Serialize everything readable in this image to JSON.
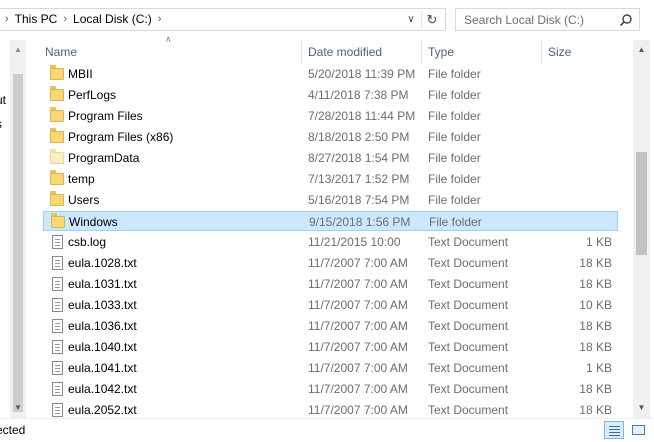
{
  "address": {
    "breadcrumbs": [
      "This PC",
      "Local Disk (C:)"
    ]
  },
  "search": {
    "placeholder": "Search Local Disk (C:)"
  },
  "nav": {
    "partial_lines": [
      "ut",
      "s"
    ]
  },
  "columns": {
    "name": "Name",
    "date": "Date modified",
    "type": "Type",
    "size": "Size"
  },
  "rows": [
    {
      "name": "MBII",
      "date": "5/20/2018 11:39 PM",
      "type": "File folder",
      "size": "",
      "icon": "folder-icon"
    },
    {
      "name": "PerfLogs",
      "date": "4/11/2018 7:38 PM",
      "type": "File folder",
      "size": "",
      "icon": "folder-icon"
    },
    {
      "name": "Program Files",
      "date": "7/28/2018 11:44 PM",
      "type": "File folder",
      "size": "",
      "icon": "folder-icon"
    },
    {
      "name": "Program Files (x86)",
      "date": "8/18/2018 2:50 PM",
      "type": "File folder",
      "size": "",
      "icon": "folder-icon"
    },
    {
      "name": "ProgramData",
      "date": "8/27/2018 1:54 PM",
      "type": "File folder",
      "size": "",
      "icon": "folder-hidden-icon"
    },
    {
      "name": "temp",
      "date": "7/13/2017 1:52 PM",
      "type": "File folder",
      "size": "",
      "icon": "folder-icon"
    },
    {
      "name": "Users",
      "date": "5/16/2018 7:54 PM",
      "type": "File folder",
      "size": "",
      "icon": "folder-icon"
    },
    {
      "name": "Windows",
      "date": "9/15/2018 1:56 PM",
      "type": "File folder",
      "size": "",
      "icon": "folder-icon",
      "selected": true
    },
    {
      "name": "csb.log",
      "date": "11/21/2015 10:00",
      "type": "Text Document",
      "size": "1 KB",
      "icon": "text-document-icon"
    },
    {
      "name": "eula.1028.txt",
      "date": "11/7/2007 7:00 AM",
      "type": "Text Document",
      "size": "18 KB",
      "icon": "text-document-icon"
    },
    {
      "name": "eula.1031.txt",
      "date": "11/7/2007 7:00 AM",
      "type": "Text Document",
      "size": "18 KB",
      "icon": "text-document-icon"
    },
    {
      "name": "eula.1033.txt",
      "date": "11/7/2007 7:00 AM",
      "type": "Text Document",
      "size": "10 KB",
      "icon": "text-document-icon"
    },
    {
      "name": "eula.1036.txt",
      "date": "11/7/2007 7:00 AM",
      "type": "Text Document",
      "size": "18 KB",
      "icon": "text-document-icon"
    },
    {
      "name": "eula.1040.txt",
      "date": "11/7/2007 7:00 AM",
      "type": "Text Document",
      "size": "18 KB",
      "icon": "text-document-icon"
    },
    {
      "name": "eula.1041.txt",
      "date": "11/7/2007 7:00 AM",
      "type": "Text Document",
      "size": "1 KB",
      "icon": "text-document-icon"
    },
    {
      "name": "eula.1042.txt",
      "date": "11/7/2007 7:00 AM",
      "type": "Text Document",
      "size": "18 KB",
      "icon": "text-document-icon"
    },
    {
      "name": "eula.2052.txt",
      "date": "11/7/2007 7:00 AM",
      "type": "Text Document",
      "size": "18 KB",
      "icon": "text-document-icon"
    }
  ],
  "status": {
    "text": "ected"
  },
  "colors": {
    "selection_bg": "#cce8ff",
    "selection_border": "#99d1ff",
    "header_text": "#4c607a",
    "folder": "#f8d775"
  }
}
